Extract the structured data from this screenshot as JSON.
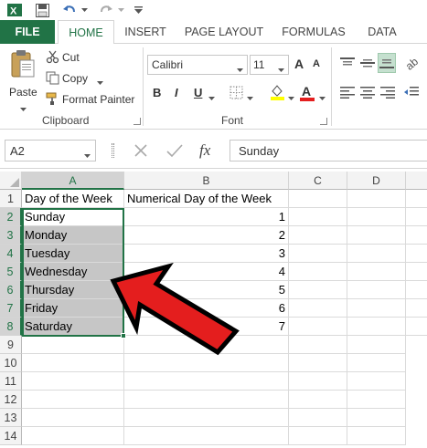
{
  "quick_access": {
    "icons": [
      "excel-logo-icon",
      "save-icon",
      "undo-icon",
      "redo-icon",
      "customize-icon"
    ],
    "excel_letter": "X"
  },
  "tabs": [
    {
      "label": "FILE"
    },
    {
      "label": "HOME"
    },
    {
      "label": "INSERT"
    },
    {
      "label": "PAGE LAYOUT"
    },
    {
      "label": "FORMULAS"
    },
    {
      "label": "DATA"
    }
  ],
  "ribbon": {
    "clipboard": {
      "paste_label": "Paste",
      "cut_label": "Cut",
      "copy_label": "Copy",
      "format_painter_label": "Format Painter",
      "group_label": "Clipboard"
    },
    "font": {
      "font_name": "Calibri",
      "font_size": "11",
      "bold": "B",
      "italic": "I",
      "underline": "U",
      "font_color_letter": "A",
      "grow_letter": "A",
      "shrink_letter": "A",
      "group_label": "Font"
    }
  },
  "formula_bar": {
    "name_box": "A2",
    "fx_label": "fx",
    "content": "Sunday"
  },
  "sheet": {
    "columns": [
      "A",
      "B",
      "C",
      "D"
    ],
    "rows": [
      "1",
      "2",
      "3",
      "4",
      "5",
      "6",
      "7",
      "8",
      "9",
      "10",
      "11",
      "12",
      "13",
      "14"
    ],
    "cells_a": [
      "Day of the Week",
      "Sunday",
      "Monday",
      "Tuesday",
      "Wednesday",
      "Thursday",
      "Friday",
      "Saturday"
    ],
    "cells_b": [
      "Numerical Day of the Week",
      "1",
      "2",
      "3",
      "4",
      "5",
      "6",
      "7"
    ]
  },
  "colors": {
    "accent": "#217346",
    "arrow": "#e41e1e",
    "selection": "#c6c6c6"
  }
}
